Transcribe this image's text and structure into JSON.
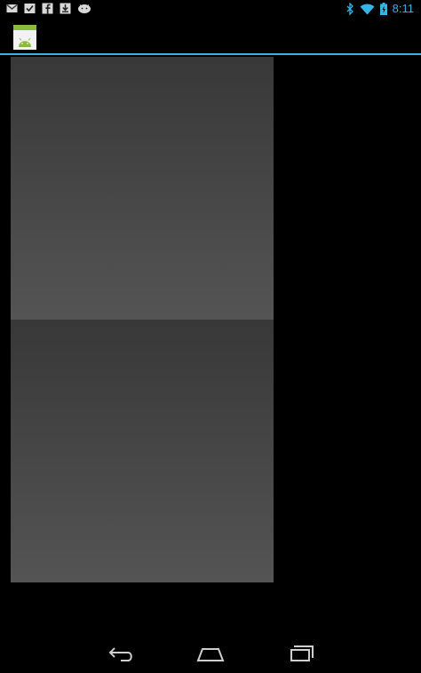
{
  "status_bar": {
    "notification_icons": [
      "gmail-icon",
      "tasks-icon",
      "facebook-icon",
      "download-icon",
      "android-debug-icon"
    ],
    "system_icons": [
      "bluetooth-icon",
      "wifi-icon",
      "battery-icon"
    ],
    "time": "8:11",
    "accent_color": "#33b5e5"
  },
  "action_bar": {
    "app_icon": "android-app-icon",
    "divider_color": "#33b5e5"
  },
  "content": {
    "panels": [
      {
        "name": "gradient-panel-top",
        "gradient": [
          "#383838",
          "#545454"
        ]
      },
      {
        "name": "gradient-panel-bottom",
        "gradient": [
          "#383838",
          "#545454"
        ]
      }
    ]
  },
  "navigation_bar": {
    "buttons": [
      "back-icon",
      "home-icon",
      "recents-icon"
    ]
  }
}
